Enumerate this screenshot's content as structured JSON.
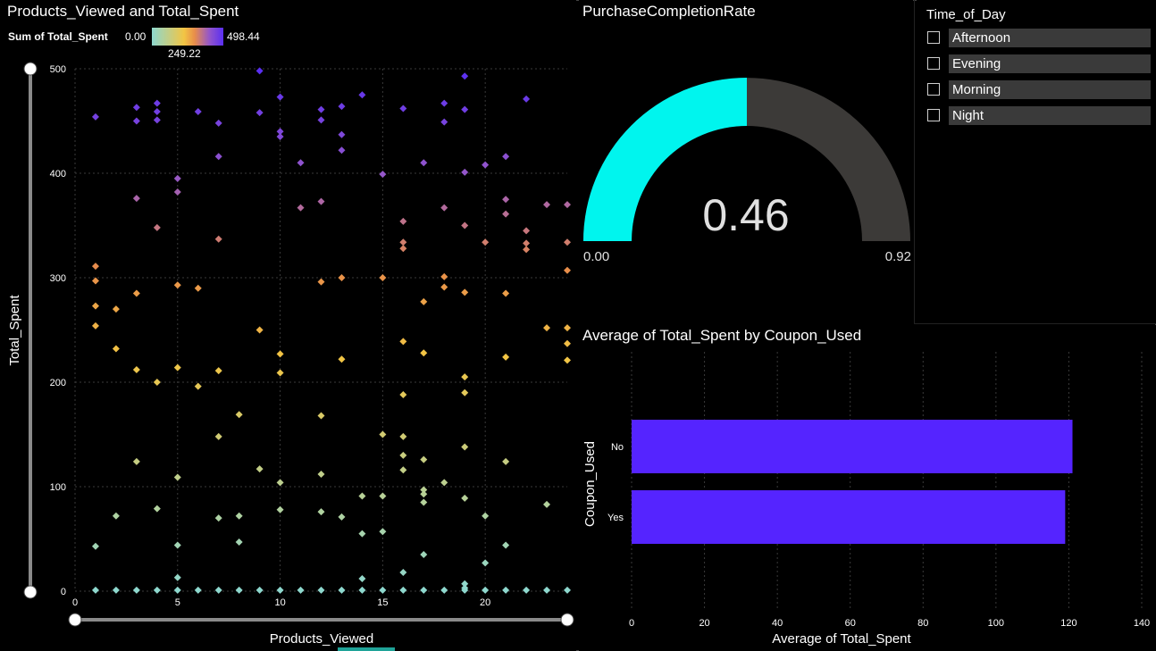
{
  "scatter": {
    "title": "Products_Viewed and Total_Spent",
    "legend": {
      "title": "Sum of Total_Spent",
      "min": "0.00",
      "mid": "249.22",
      "max": "498.44"
    },
    "chart_data": {
      "type": "scatter",
      "title": "Products_Viewed and Total_Spent",
      "xlabel": "Products_Viewed",
      "ylabel": "Total_Spent",
      "xlim": [
        0,
        24
      ],
      "ylim": [
        0,
        500
      ],
      "xticks": [
        "0",
        "5",
        "10",
        "15",
        "20"
      ],
      "yticks": [
        "0",
        "100",
        "200",
        "300",
        "400",
        "500"
      ],
      "color_range": [
        0,
        498.44
      ],
      "points": [
        [
          1,
          454
        ],
        [
          3,
          463
        ],
        [
          3,
          450
        ],
        [
          4,
          467
        ],
        [
          4,
          459
        ],
        [
          4,
          451
        ],
        [
          6,
          459
        ],
        [
          7,
          448
        ],
        [
          7,
          416
        ],
        [
          9,
          498
        ],
        [
          9,
          458
        ],
        [
          10,
          473
        ],
        [
          10,
          440
        ],
        [
          10,
          435
        ],
        [
          11,
          410
        ],
        [
          12,
          461
        ],
        [
          12,
          451
        ],
        [
          13,
          464
        ],
        [
          13,
          437
        ],
        [
          13,
          422
        ],
        [
          14,
          475
        ],
        [
          16,
          462
        ],
        [
          17,
          410
        ],
        [
          18,
          467
        ],
        [
          18,
          449
        ],
        [
          19,
          493
        ],
        [
          19,
          461
        ],
        [
          19,
          401
        ],
        [
          20,
          408
        ],
        [
          21,
          416
        ],
        [
          22,
          471
        ],
        [
          3,
          376
        ],
        [
          4,
          348
        ],
        [
          5,
          395
        ],
        [
          5,
          382
        ],
        [
          7,
          337
        ],
        [
          11,
          367
        ],
        [
          12,
          373
        ],
        [
          15,
          399
        ],
        [
          16,
          354
        ],
        [
          16,
          334
        ],
        [
          16,
          328
        ],
        [
          18,
          367
        ],
        [
          19,
          350
        ],
        [
          20,
          334
        ],
        [
          21,
          375
        ],
        [
          21,
          361
        ],
        [
          22,
          345
        ],
        [
          22,
          333
        ],
        [
          22,
          327
        ],
        [
          23,
          370
        ],
        [
          24,
          370
        ],
        [
          24,
          334
        ],
        [
          1,
          311
        ],
        [
          1,
          297
        ],
        [
          1,
          273
        ],
        [
          1,
          254
        ],
        [
          2,
          270
        ],
        [
          2,
          232
        ],
        [
          3,
          285
        ],
        [
          3,
          212
        ],
        [
          4,
          200
        ],
        [
          5,
          293
        ],
        [
          5,
          214
        ],
        [
          6,
          290
        ],
        [
          6,
          196
        ],
        [
          7,
          211
        ],
        [
          9,
          250
        ],
        [
          10,
          227
        ],
        [
          10,
          209
        ],
        [
          12,
          296
        ],
        [
          13,
          300
        ],
        [
          13,
          222
        ],
        [
          15,
          300
        ],
        [
          16,
          239
        ],
        [
          16,
          188
        ],
        [
          17,
          277
        ],
        [
          17,
          228
        ],
        [
          18,
          301
        ],
        [
          18,
          291
        ],
        [
          19,
          286
        ],
        [
          19,
          205
        ],
        [
          19,
          190
        ],
        [
          21,
          285
        ],
        [
          21,
          224
        ],
        [
          23,
          252
        ],
        [
          24,
          307
        ],
        [
          24,
          252
        ],
        [
          24,
          237
        ],
        [
          24,
          221
        ],
        [
          3,
          124
        ],
        [
          5,
          109
        ],
        [
          7,
          148
        ],
        [
          8,
          169
        ],
        [
          9,
          117
        ],
        [
          10,
          104
        ],
        [
          12,
          168
        ],
        [
          12,
          112
        ],
        [
          15,
          150
        ],
        [
          16,
          148
        ],
        [
          16,
          130
        ],
        [
          16,
          116
        ],
        [
          17,
          126
        ],
        [
          17,
          97
        ],
        [
          17,
          93
        ],
        [
          17,
          85
        ],
        [
          18,
          104
        ],
        [
          19,
          138
        ],
        [
          19,
          89
        ],
        [
          21,
          124
        ],
        [
          23,
          83
        ],
        [
          1,
          43
        ],
        [
          2,
          72
        ],
        [
          4,
          79
        ],
        [
          5,
          44
        ],
        [
          7,
          70
        ],
        [
          8,
          72
        ],
        [
          8,
          47
        ],
        [
          10,
          78
        ],
        [
          12,
          76
        ],
        [
          13,
          71
        ],
        [
          14,
          91
        ],
        [
          14,
          55
        ],
        [
          15,
          91
        ],
        [
          15,
          57
        ],
        [
          16,
          18
        ],
        [
          17,
          35
        ],
        [
          20,
          72
        ],
        [
          20,
          27
        ],
        [
          21,
          44
        ],
        [
          19,
          7
        ],
        [
          19,
          3
        ],
        [
          5,
          13
        ],
        [
          14,
          12
        ],
        [
          1,
          1
        ],
        [
          2,
          1
        ],
        [
          3,
          1
        ],
        [
          4,
          1
        ],
        [
          5,
          1
        ],
        [
          6,
          1
        ],
        [
          7,
          1
        ],
        [
          8,
          1
        ],
        [
          9,
          1
        ],
        [
          10,
          1
        ],
        [
          11,
          1
        ],
        [
          12,
          1
        ],
        [
          13,
          1
        ],
        [
          14,
          1
        ],
        [
          15,
          1
        ],
        [
          16,
          1
        ],
        [
          17,
          1
        ],
        [
          18,
          1
        ],
        [
          19,
          1
        ],
        [
          20,
          1
        ],
        [
          21,
          1
        ],
        [
          22,
          1
        ],
        [
          23,
          1
        ],
        [
          24,
          1
        ]
      ]
    }
  },
  "gauge": {
    "title": "PurchaseCompletionRate",
    "value_label": "0.46",
    "min_label": "0.00",
    "max_label": "0.92",
    "value": 0.46,
    "min": 0,
    "max": 0.92,
    "fill_color": "#00f5ee",
    "track_color": "#3c3a38"
  },
  "slicer": {
    "title": "Time_of_Day",
    "items": [
      "Afternoon",
      "Evening",
      "Morning",
      "Night"
    ]
  },
  "bar": {
    "title": "Average of Total_Spent by Coupon_Used",
    "chart_data": {
      "type": "bar",
      "orientation": "horizontal",
      "title": "Average of Total_Spent by Coupon_Used",
      "categories": [
        "No",
        "Yes"
      ],
      "values": [
        121,
        119
      ],
      "xlabel": "Average of Total_Spent",
      "ylabel": "Coupon_Used",
      "xlim": [
        0,
        140
      ],
      "xticks": [
        "0",
        "20",
        "40",
        "60",
        "80",
        "100",
        "120",
        "140"
      ],
      "color": "#5524ff",
      "grid": true
    }
  }
}
